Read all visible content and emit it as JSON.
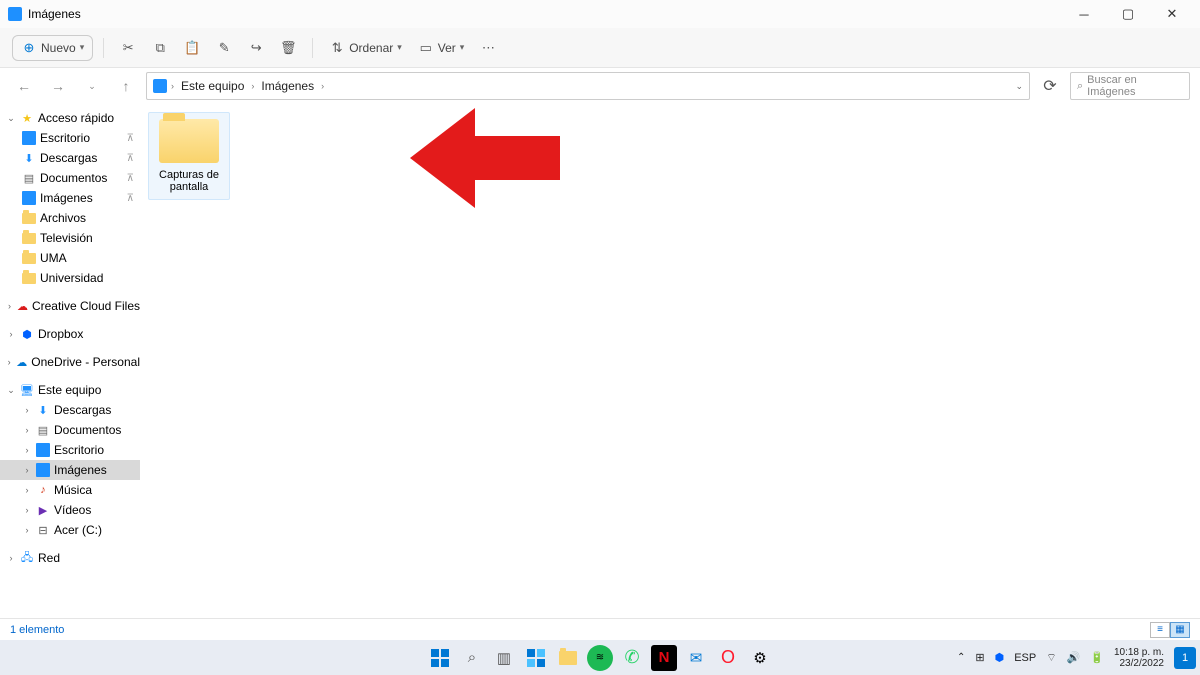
{
  "window_title": "Imágenes",
  "toolbar": {
    "new_label": "Nuevo",
    "sort_label": "Ordenar",
    "view_label": "Ver"
  },
  "breadcrumb": {
    "root": "Este equipo",
    "current": "Imágenes"
  },
  "search_placeholder": "Buscar en Imágenes",
  "sidebar": {
    "quick_access": "Acceso rápido",
    "desktop": "Escritorio",
    "downloads": "Descargas",
    "documents": "Documentos",
    "pictures": "Imágenes",
    "archivos": "Archivos",
    "television": "Televisión",
    "uma": "UMA",
    "universidad": "Universidad",
    "creative_cloud": "Creative Cloud Files",
    "dropbox": "Dropbox",
    "onedrive": "OneDrive - Personal",
    "this_pc": "Este equipo",
    "pc_downloads": "Descargas",
    "pc_documents": "Documentos",
    "pc_desktop": "Escritorio",
    "pc_pictures": "Imágenes",
    "pc_music": "Música",
    "pc_videos": "Vídeos",
    "pc_drive": "Acer (C:)",
    "network": "Red"
  },
  "content": {
    "folder_name": "Capturas de pantalla"
  },
  "status": {
    "count_label": "1 elemento"
  },
  "taskbar": {
    "lang": "ESP",
    "time": "10:18 p. m.",
    "date": "23/2/2022",
    "notif_count": "1"
  }
}
